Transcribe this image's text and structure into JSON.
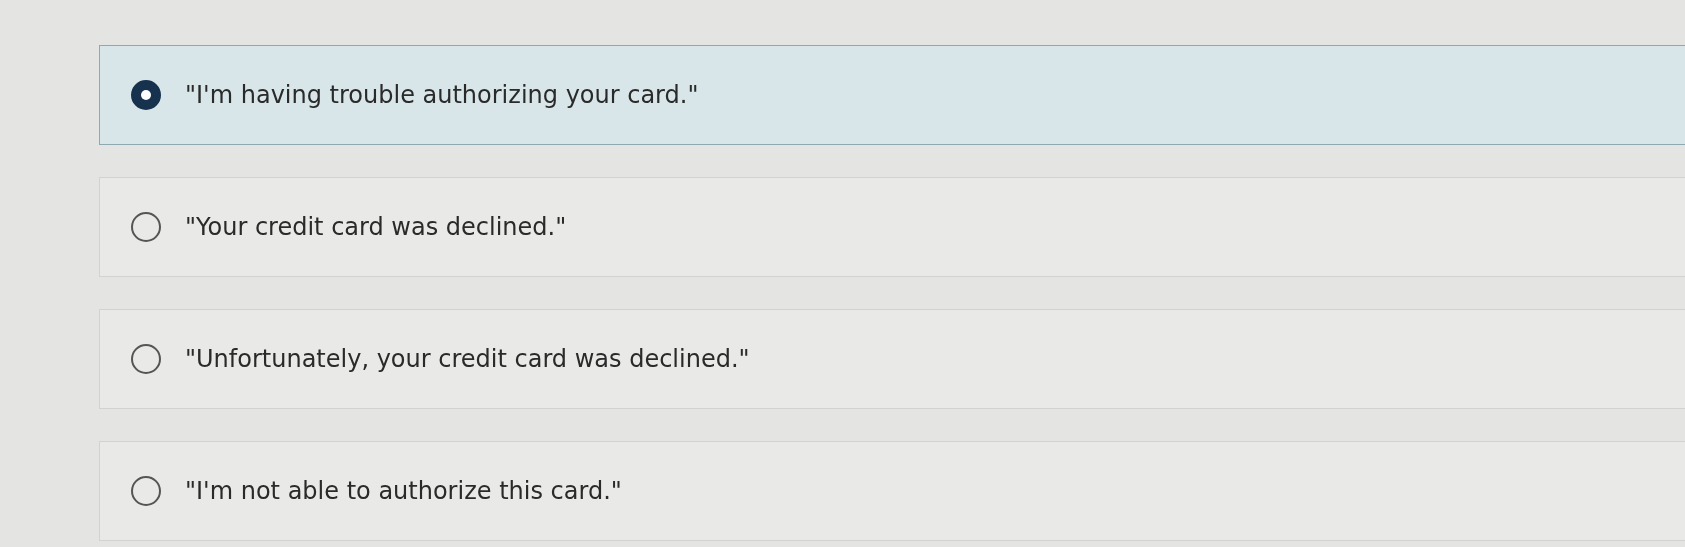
{
  "options": [
    {
      "label": "\"I'm having trouble authorizing your card.\"",
      "selected": true
    },
    {
      "label": "\"Your credit card was declined.\"",
      "selected": false
    },
    {
      "label": "\"Unfortunately, your credit card was declined.\"",
      "selected": false
    },
    {
      "label": "\"I'm not able to authorize this card.\"",
      "selected": false
    }
  ]
}
